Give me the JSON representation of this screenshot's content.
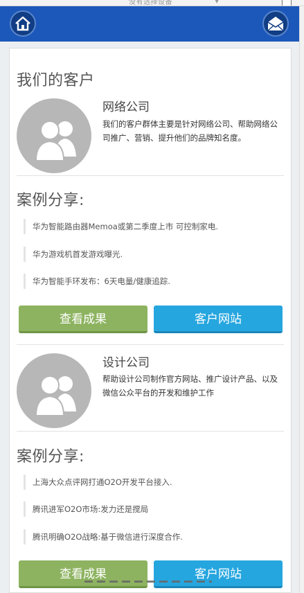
{
  "top_strip": {
    "device_text": "没有选择设备"
  },
  "header": {
    "home_icon": "home-icon",
    "mail_icon": "mail-icon"
  },
  "customers": {
    "title": "我们的客户"
  },
  "companies": [
    {
      "name": "网络公司",
      "description": "我们的客户群体主要是针对网络公司、帮助网络公司推广、营销、提升他们的品牌知名度。",
      "cases_title": "案例分享:",
      "cases": [
        "华为智能路由器Memoa或第二季度上市 可控制家电.",
        "华为游戏机首发游戏曝光.",
        "华为智能手环发布：6天电量/健康追踪."
      ],
      "result_button": "查看成果",
      "site_button": "客户网站"
    },
    {
      "name": "设计公司",
      "description": "帮助设计公司制作官方网站、推广设计产品、以及微信公众平台的开发和维护工作",
      "cases_title": "案例分享:",
      "cases": [
        "上海大众点评网打通O2O开发平台接入.",
        "腾讯进军O2O市场:发力还是搅局",
        "腾讯明确O2O战略:基于微信进行深度合作."
      ],
      "result_button": "查看成果",
      "site_button": "客户网站"
    }
  ],
  "colors": {
    "header": "#1c58b9",
    "result_button": "#8db360",
    "site_button": "#26a6df"
  }
}
